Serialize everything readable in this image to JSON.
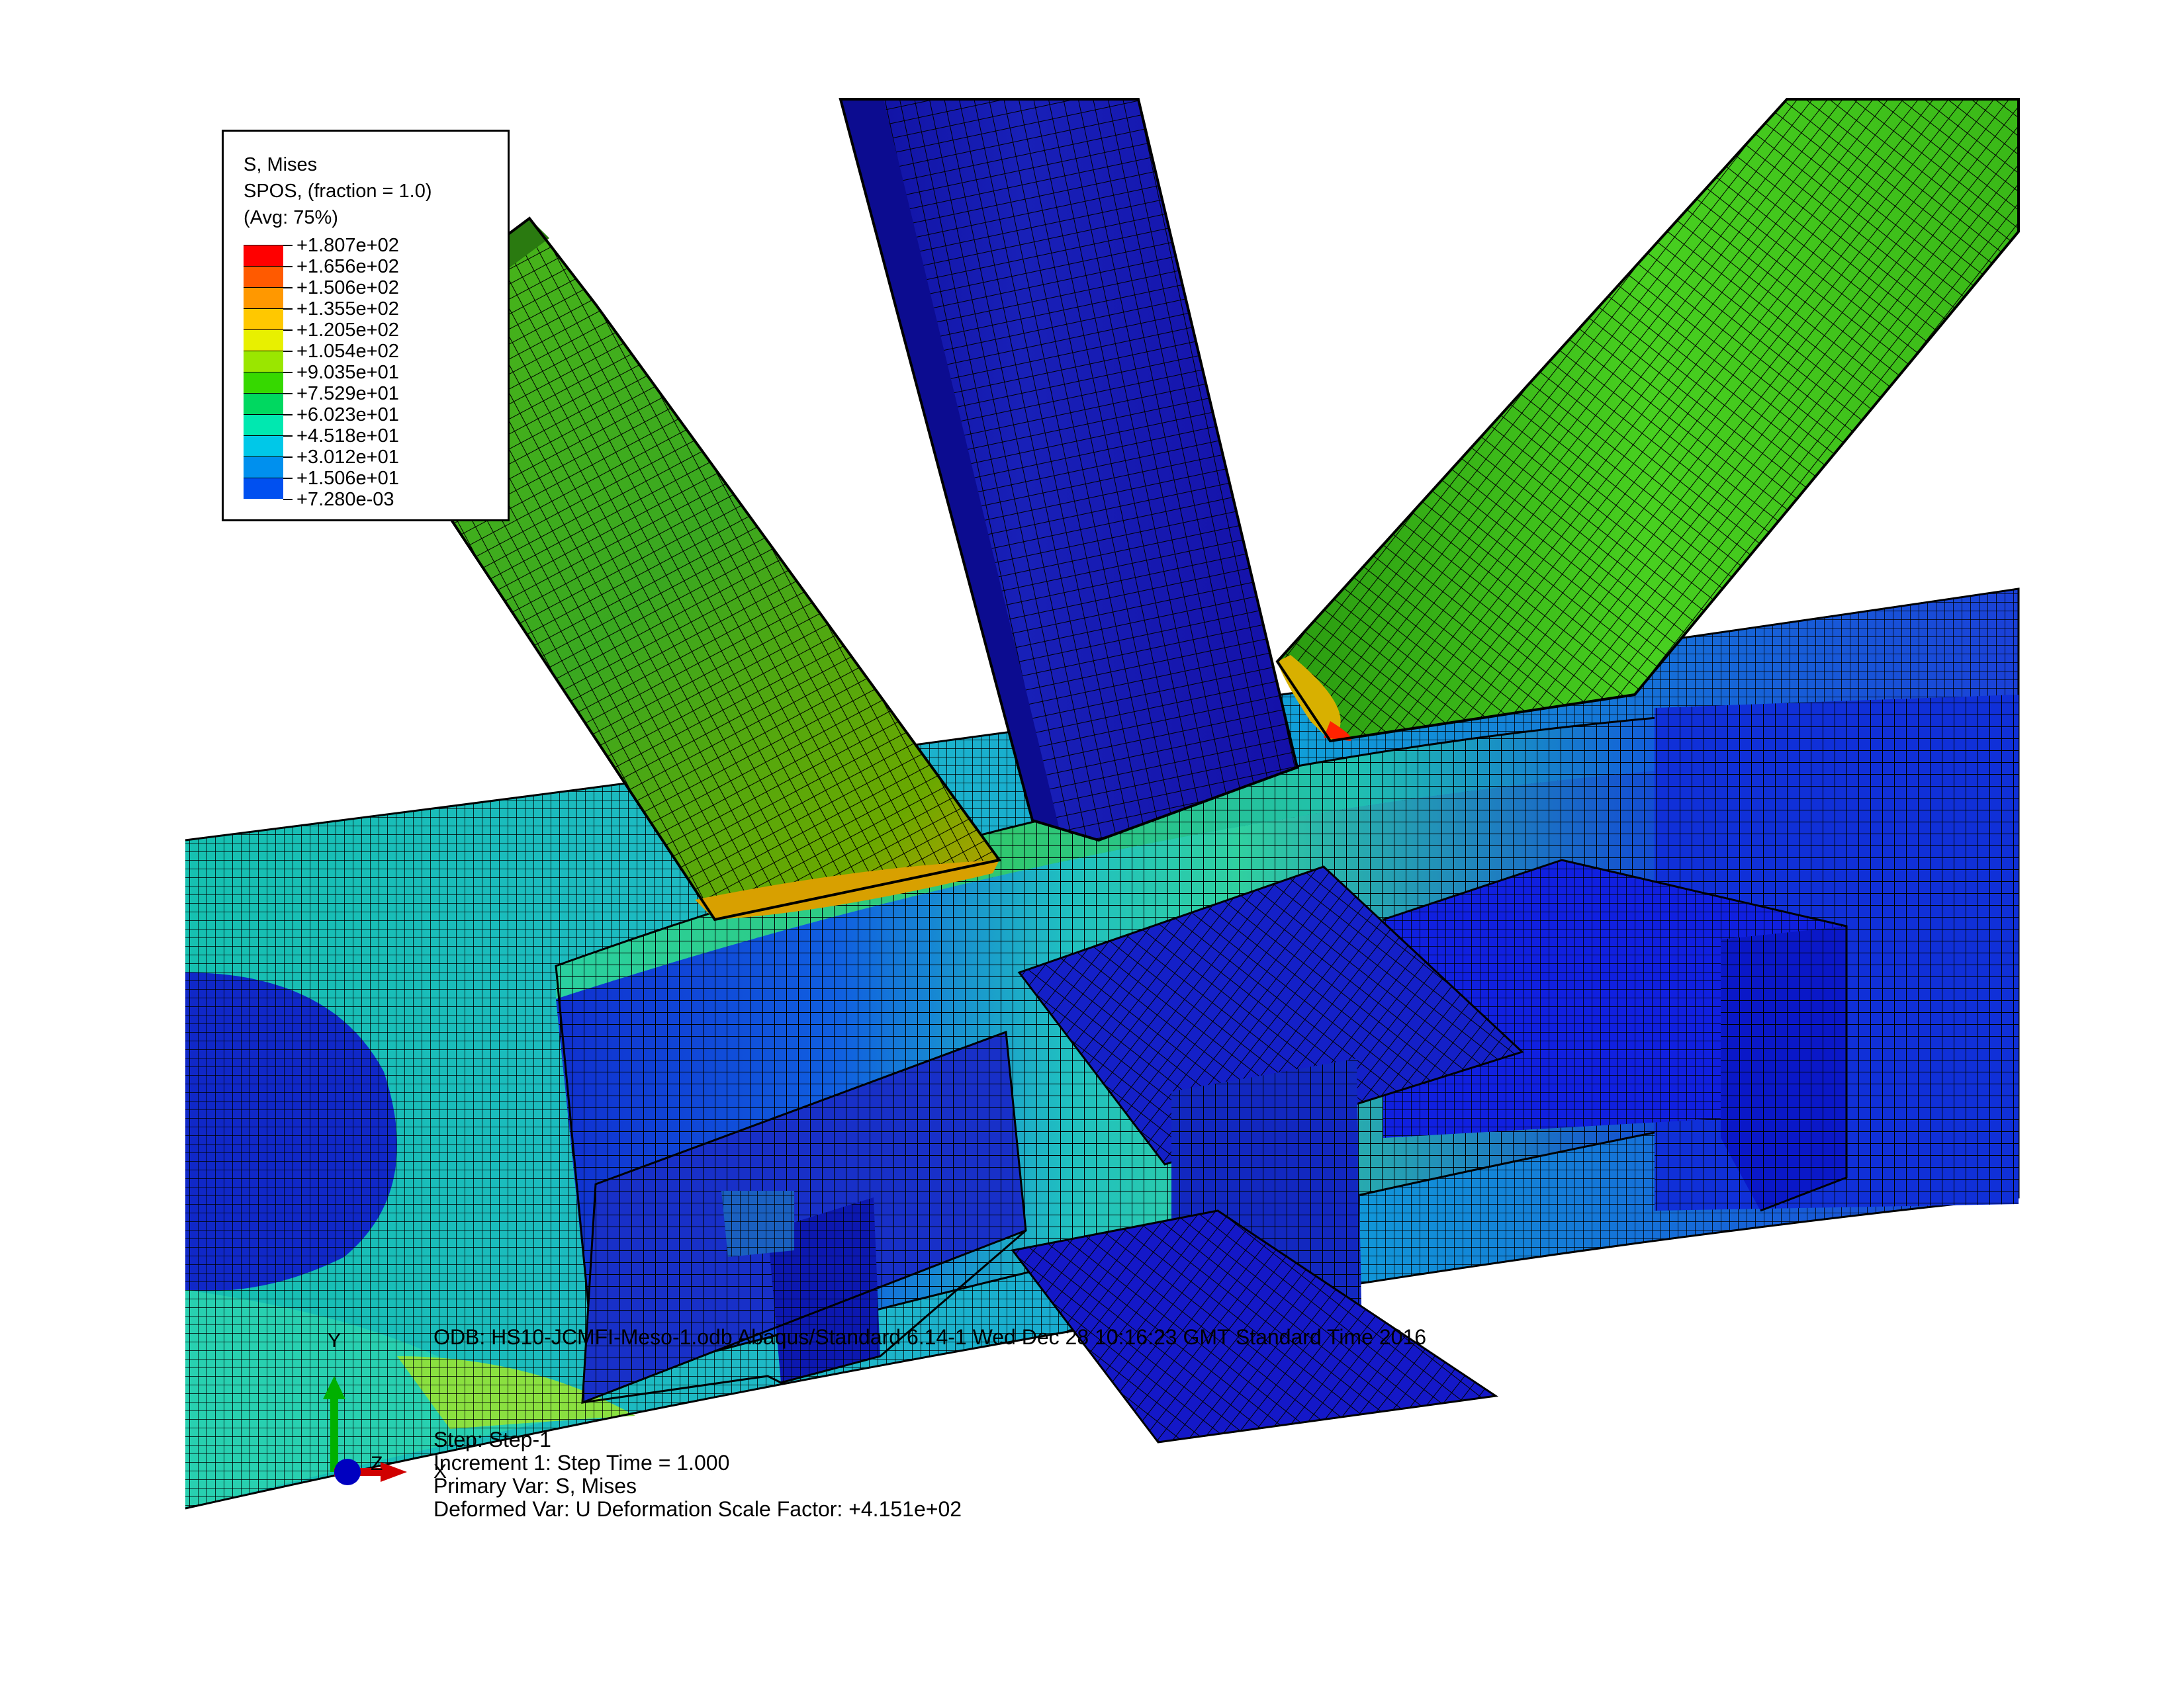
{
  "legend": {
    "title": "S, Mises",
    "section": "SPOS, (fraction = 1.0)",
    "averaging": "(Avg: 75%)",
    "entries": [
      {
        "value": "+1.807e+02",
        "color": "#ff0000"
      },
      {
        "value": "+1.656e+02",
        "color": "#ff5a00"
      },
      {
        "value": "+1.506e+02",
        "color": "#ff9800"
      },
      {
        "value": "+1.355e+02",
        "color": "#ffc800"
      },
      {
        "value": "+1.205e+02",
        "color": "#e8f000"
      },
      {
        "value": "+1.054e+02",
        "color": "#9ae600"
      },
      {
        "value": "+9.035e+01",
        "color": "#36d800"
      },
      {
        "value": "+7.529e+01",
        "color": "#00d860"
      },
      {
        "value": "+6.023e+01",
        "color": "#00e8b0"
      },
      {
        "value": "+4.518e+01",
        "color": "#00c8e8"
      },
      {
        "value": "+3.012e+01",
        "color": "#0090ee"
      },
      {
        "value": "+1.506e+01",
        "color": "#0050f0"
      },
      {
        "value": "+7.280e-03",
        "color": "#0010d8"
      }
    ]
  },
  "status": {
    "odb_line": "ODB: HS10-JCMFI-Meso-1.odb    Abaqus/Standard 6.14-1    Wed Dec 28 10:16:23 GMT Standard Time 2016",
    "step_line": "Step: Step-1",
    "increment_line": "Increment      1: Step Time =    1.000",
    "primary_var": "Primary Var: S, Mises",
    "deformed_var": "Deformed Var: U   Deformation Scale Factor: +4.151e+02"
  },
  "triad": {
    "y_label": "Y",
    "z_label": "Z",
    "x_label": "X",
    "y_color": "#00b000",
    "x_color": "#d00000",
    "z_color": "#0000c0"
  }
}
